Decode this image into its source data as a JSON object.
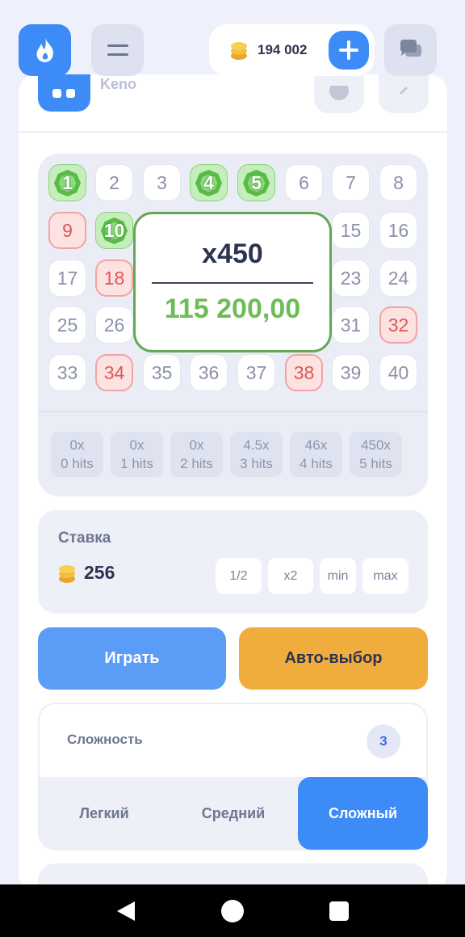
{
  "header": {
    "balance": "194 002",
    "icons": {
      "logo": "flame-icon",
      "menu": "hamburger-icon",
      "coins": "coin-stack-icon",
      "add": "plus-icon",
      "chat": "chat-icon"
    }
  },
  "game": {
    "title": "Keno"
  },
  "board": {
    "cells": [
      {
        "n": "1",
        "state": "hit"
      },
      {
        "n": "2",
        "state": "normal"
      },
      {
        "n": "3",
        "state": "normal"
      },
      {
        "n": "4",
        "state": "hit"
      },
      {
        "n": "5",
        "state": "hit"
      },
      {
        "n": "6",
        "state": "normal"
      },
      {
        "n": "7",
        "state": "normal"
      },
      {
        "n": "8",
        "state": "normal"
      },
      {
        "n": "9",
        "state": "miss"
      },
      {
        "n": "10",
        "state": "hit"
      },
      {
        "n": "15",
        "state": "normal"
      },
      {
        "n": "16",
        "state": "normal"
      },
      {
        "n": "17",
        "state": "normal"
      },
      {
        "n": "18",
        "state": "miss"
      },
      {
        "n": "23",
        "state": "normal"
      },
      {
        "n": "24",
        "state": "normal"
      },
      {
        "n": "25",
        "state": "normal"
      },
      {
        "n": "26",
        "state": "normal"
      },
      {
        "n": "31",
        "state": "normal"
      },
      {
        "n": "32",
        "state": "miss"
      },
      {
        "n": "33",
        "state": "normal"
      },
      {
        "n": "34",
        "state": "miss"
      },
      {
        "n": "35",
        "state": "normal"
      },
      {
        "n": "36",
        "state": "normal"
      },
      {
        "n": "37",
        "state": "normal"
      },
      {
        "n": "38",
        "state": "miss"
      },
      {
        "n": "39",
        "state": "normal"
      },
      {
        "n": "40",
        "state": "normal"
      }
    ],
    "win": {
      "multiplier": "x450",
      "amount": "115 200,00"
    },
    "payouts": [
      {
        "mult": "0x",
        "hits": "0 hits"
      },
      {
        "mult": "0x",
        "hits": "1 hits"
      },
      {
        "mult": "0x",
        "hits": "2 hits"
      },
      {
        "mult": "4.5x",
        "hits": "3 hits"
      },
      {
        "mult": "46x",
        "hits": "4 hits"
      },
      {
        "mult": "450x",
        "hits": "5 hits"
      }
    ]
  },
  "stake": {
    "label": "Ставка",
    "value": "256",
    "buttons": {
      "half": "1/2",
      "double": "x2",
      "min": "min",
      "max": "max"
    }
  },
  "actions": {
    "play": "Играть",
    "auto": "Авто-выбор"
  },
  "difficulty": {
    "label": "Сложность",
    "badge": "3",
    "tabs": {
      "easy": "Легкий",
      "medium": "Средний",
      "hard": "Сложный"
    },
    "selected": "hard"
  },
  "colors": {
    "accent": "#3c8bf7",
    "hit": "#c6eebd",
    "miss": "#fde2e2",
    "win": "#6dbd57",
    "auto": "#f1ac3e"
  }
}
